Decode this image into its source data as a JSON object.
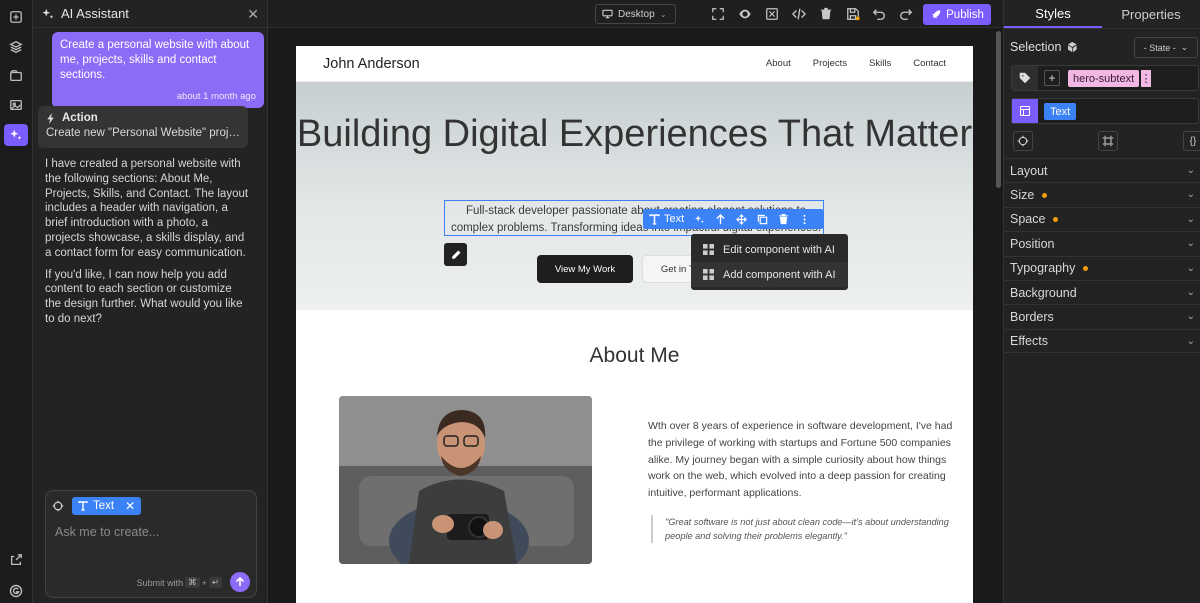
{
  "ai_panel": {
    "title": "AI Assistant",
    "user_message": "Create a personal website with about me, projects, skills and contact sections.",
    "user_message_time": "about 1 month ago",
    "action_title": "Action",
    "action_subtitle": "Create new \"Personal Website\" project",
    "reply_paragraphs": [
      "I have created a personal website with the following sections: About Me, Projects, Skills, and Contact. The layout includes a header with navigation, a brief introduction with a photo, a projects showcase, a skills display, and a contact form for easy communication.",
      "If you'd like, I can now help you add content to each section or customize the design further. What would you like to do next?"
    ],
    "input_chip": "Text",
    "input_placeholder": "Ask me to create...",
    "submit_hint": "Submit with",
    "submit_keys": [
      "⌘",
      "+",
      "↵"
    ]
  },
  "toolbar": {
    "device": "Desktop",
    "publish_label": "Publish"
  },
  "site": {
    "logo": "John Anderson",
    "nav_links": [
      "About",
      "Projects",
      "Skills",
      "Contact"
    ],
    "hero_title": "Building Digital Experiences That Matter",
    "hero_subtitle": "Full-stack developer passionate about creating elegant solutions to complex problems. Transforming ideas into impactful digital experiences.",
    "primary_cta": "View My Work",
    "secondary_cta": "Get in Touch",
    "about_title": "About Me",
    "about_text": "Wth over 8 years of experience in software development, I've had the privilege of working with startups and Fortune 500 companies alike. My journey began with a simple curiosity about how things work on the web, which evolved into a deep passion for creating intuitive, performant applications.",
    "quote": "\"Great software is not just about clean code—it's about understanding people and solving their problems elegantly.\""
  },
  "component_toolbar": {
    "label": "Text"
  },
  "context_menu": {
    "items": [
      "Edit component with AI",
      "Add component with AI"
    ]
  },
  "right_panel": {
    "tabs": [
      "Styles",
      "Properties"
    ],
    "selection_label": "Selection",
    "state_select": "- State -",
    "class_chip": "hero-subtext",
    "component_type": "Text",
    "sections": [
      {
        "label": "Layout",
        "modified": false
      },
      {
        "label": "Size",
        "modified": true
      },
      {
        "label": "Space",
        "modified": true
      },
      {
        "label": "Position",
        "modified": false
      },
      {
        "label": "Typography",
        "modified": true
      },
      {
        "label": "Background",
        "modified": false
      },
      {
        "label": "Borders",
        "modified": false
      },
      {
        "label": "Effects",
        "modified": false
      }
    ]
  },
  "colors": {
    "accent": "#7b5cff",
    "selection_blue": "#3b82f6",
    "class_chip_pink": "#f2b8e3",
    "modified_dot": "#f59e0b"
  }
}
